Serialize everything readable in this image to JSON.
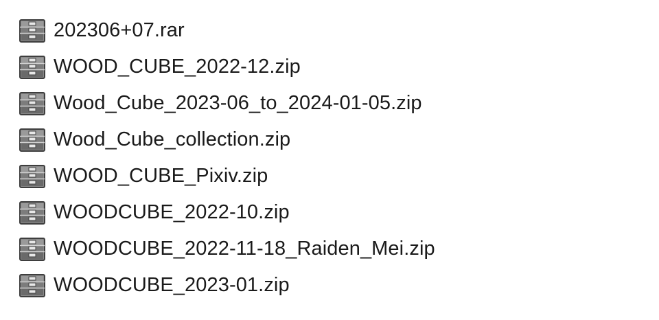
{
  "files": [
    {
      "name": "202306+07.rar",
      "icon": "archive-icon"
    },
    {
      "name": "WOOD_CUBE_2022-12.zip",
      "icon": "archive-icon"
    },
    {
      "name": "Wood_Cube_2023-06_to_2024-01-05.zip",
      "icon": "archive-icon"
    },
    {
      "name": "Wood_Cube_collection.zip",
      "icon": "archive-icon"
    },
    {
      "name": "WOOD_CUBE_Pixiv.zip",
      "icon": "archive-icon"
    },
    {
      "name": "WOODCUBE_2022-10.zip",
      "icon": "archive-icon"
    },
    {
      "name": "WOODCUBE_2022-11-18_Raiden_Mei.zip",
      "icon": "archive-icon"
    },
    {
      "name": "WOODCUBE_2023-01.zip",
      "icon": "archive-icon"
    }
  ],
  "colors": {
    "text": "#1a1a1a",
    "icon_dark": "#4a4a4a",
    "icon_mid": "#7a7a7a",
    "icon_light": "#c8c8c8",
    "background": "#ffffff"
  }
}
